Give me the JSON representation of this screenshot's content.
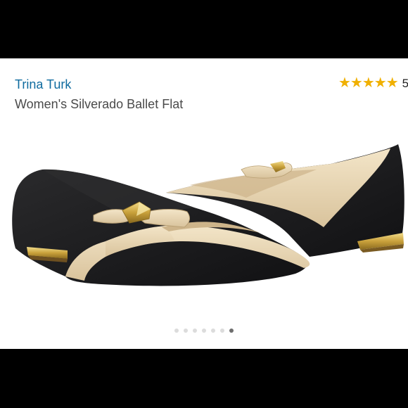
{
  "product": {
    "brand": "Trina Turk",
    "title": "Women's Silverado Ballet Flat"
  },
  "rating": {
    "stars_text": "★★★★★",
    "value": 5,
    "count": "5"
  },
  "carousel": {
    "total": 7,
    "active_index": 6
  },
  "colors": {
    "brand_link": "#0f6b9f",
    "star": "#f0b000",
    "shoe_black": "#1b1b1d",
    "shoe_cream": "#ead8b6",
    "hardware_gold": "#c9a13b"
  },
  "image": {
    "icon": "product-photo"
  }
}
